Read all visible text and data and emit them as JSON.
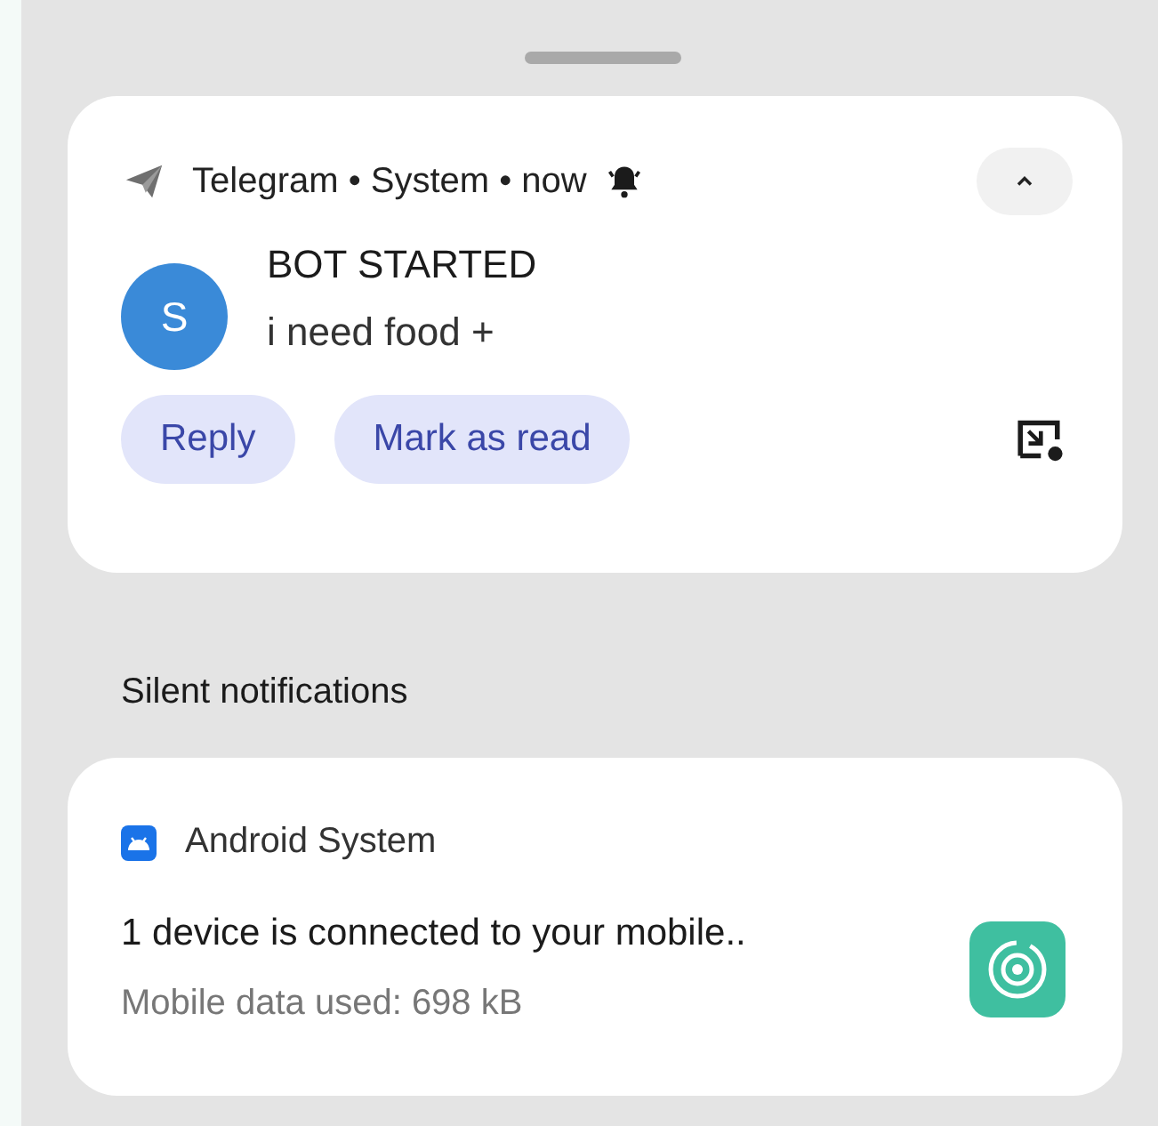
{
  "conversation_notification": {
    "header": "Telegram • System • now",
    "alerting": true,
    "expanded": true,
    "avatar_letter": "S",
    "title": "BOT STARTED",
    "message": "i need food +",
    "actions": [
      "Reply",
      "Mark as read"
    ]
  },
  "section_header": "Silent notifications",
  "silent_notification": {
    "app": "Android System",
    "title": "1 device is connected to your mobile..",
    "text": "Mobile data used: 698 kB"
  }
}
